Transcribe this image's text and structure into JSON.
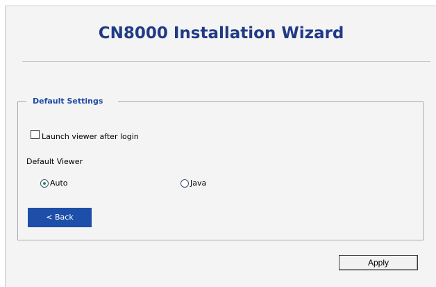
{
  "wizard": {
    "title": "CN8000 Installation Wizard"
  },
  "settings": {
    "legend": "Default Settings",
    "launch_viewer_label": "Launch viewer after login",
    "launch_viewer_checked": false,
    "default_viewer_label": "Default Viewer",
    "radio_auto_label": "Auto",
    "radio_java_label": "Java",
    "selected_viewer": "Auto",
    "back_label": "< Back"
  },
  "footer": {
    "apply_label": "Apply"
  },
  "colors": {
    "title": "#203a86",
    "legend": "#1e4aa5",
    "back_button_bg": "#1d4ea8",
    "radio_dot": "#1d9c2b",
    "panel_bg": "#f4f4f4"
  },
  "icons": {
    "checkbox": "checkbox-unchecked",
    "radio_auto": "radio-selected",
    "radio_java": "radio-unselected"
  }
}
